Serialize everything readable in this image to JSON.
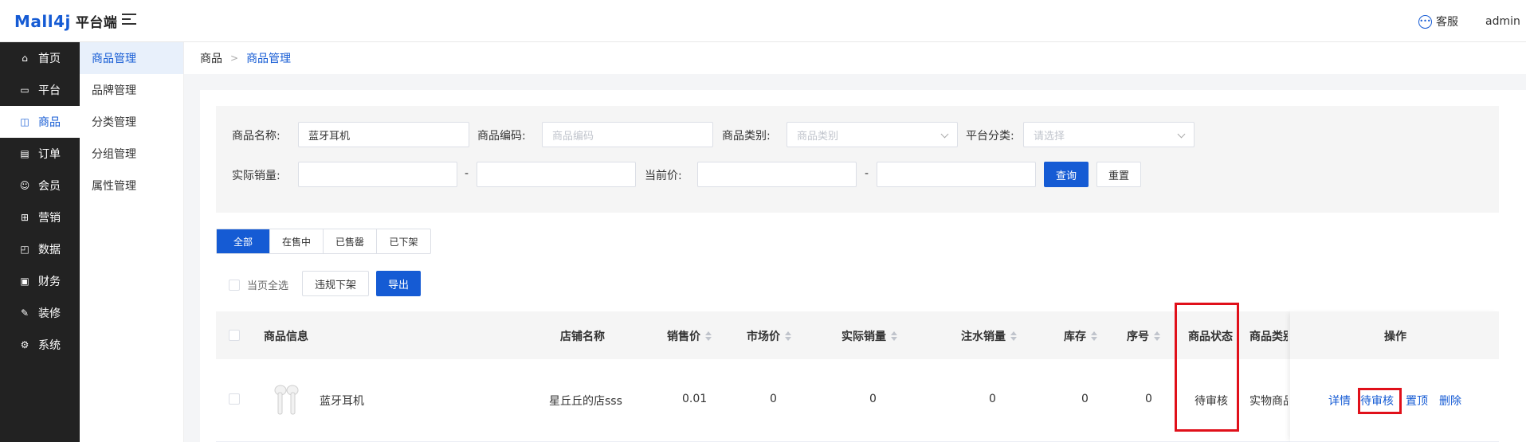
{
  "header": {
    "logo": "Mall4j",
    "platform": "平台端",
    "customer_service": "客服",
    "user": "admin"
  },
  "sidebar": {
    "items": [
      {
        "label": "首页",
        "icon": "home-icon"
      },
      {
        "label": "平台",
        "icon": "monitor-icon"
      },
      {
        "label": "商品",
        "icon": "bag-icon"
      },
      {
        "label": "订单",
        "icon": "order-icon"
      },
      {
        "label": "会员",
        "icon": "user-icon"
      },
      {
        "label": "营销",
        "icon": "gift-icon"
      },
      {
        "label": "数据",
        "icon": "chart-icon"
      },
      {
        "label": "财务",
        "icon": "finance-icon"
      },
      {
        "label": "装修",
        "icon": "brush-icon"
      },
      {
        "label": "系统",
        "icon": "gear-icon"
      }
    ],
    "active": 2
  },
  "subnav": {
    "items": [
      "商品管理",
      "品牌管理",
      "分类管理",
      "分组管理",
      "属性管理"
    ],
    "active": 0
  },
  "breadcrumb": {
    "root": "商品",
    "current": "商品管理"
  },
  "filter": {
    "name_label": "商品名称:",
    "name_value": "蓝牙耳机",
    "code_label": "商品编码:",
    "code_placeholder": "商品编码",
    "category_label": "商品类别:",
    "category_placeholder": "商品类别",
    "platform_cat_label": "平台分类:",
    "platform_cat_placeholder": "请选择",
    "sales_label": "实际销量:",
    "price_label": "当前价:",
    "dash": "-",
    "search_button": "查询",
    "reset_button": "重置"
  },
  "tabs": [
    "全部",
    "在售中",
    "已售罄",
    "已下架"
  ],
  "actions": {
    "select_page": "当页全选",
    "violation_button": "违规下架",
    "export_button": "导出"
  },
  "table": {
    "columns": [
      "商品信息",
      "店铺名称",
      "销售价",
      "市场价",
      "实际销量",
      "注水销量",
      "库存",
      "序号",
      "商品状态",
      "商品类别",
      "操作"
    ],
    "rows": [
      {
        "name": "蓝牙耳机",
        "shop": "星丘丘的店sss",
        "price": "0.01",
        "market_price": "0",
        "sales": "0",
        "fake_sales": "0",
        "stock": "0",
        "seq": "0",
        "status": "待审核",
        "type": "实物商品",
        "ops": [
          "详情",
          "待审核",
          "置顶",
          "删除"
        ]
      }
    ]
  },
  "colors": {
    "primary": "#155bd4",
    "sidebar_bg": "#222222",
    "highlight": "#e0101a"
  }
}
